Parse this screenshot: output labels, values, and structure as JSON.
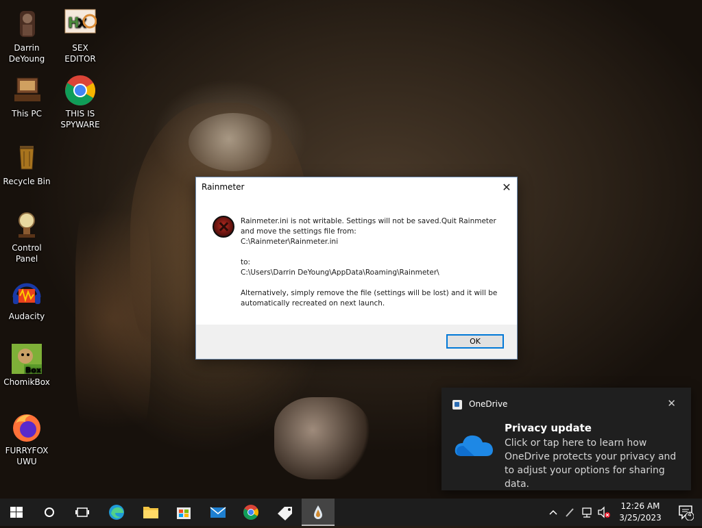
{
  "desktop": {
    "icons": [
      {
        "label": "Darrin\nDeYoung",
        "icon": "user-folder-icon"
      },
      {
        "label": "SEX\nEDITOR",
        "icon": "hex-editor-icon"
      },
      {
        "label": "This PC",
        "icon": "computer-icon"
      },
      {
        "label": "THIS IS\nSPYWARE",
        "icon": "chrome-icon"
      },
      {
        "label": "Recycle Bin",
        "icon": "recycle-bin-icon"
      },
      {
        "label": "Control Panel",
        "icon": "control-panel-icon"
      },
      {
        "label": "Audacity",
        "icon": "audacity-icon"
      },
      {
        "label": "ChomikBox",
        "icon": "chomikbox-icon"
      },
      {
        "label": "FURRYFOX\nUWU",
        "icon": "firefox-icon"
      }
    ]
  },
  "dialog": {
    "title": "Rainmeter",
    "close_glyph": "✕",
    "message_line1": "Rainmeter.ini is not writable. Settings will not be saved.Quit Rainmeter",
    "message_line2": "and move the settings file from:",
    "message_line3": "C:\\Rainmeter\\Rainmeter.ini",
    "message_line4": "to:",
    "message_line5": "C:\\Users\\Darrin DeYoung\\AppData\\Roaming\\Rainmeter\\",
    "message_line6": "Alternatively, simply remove the file (settings will be lost) and it will be",
    "message_line7": "automatically recreated on next launch.",
    "ok_label": "OK"
  },
  "toast": {
    "app_name": "OneDrive",
    "close_glyph": "✕",
    "heading": "Privacy update",
    "body": "Click or tap here to learn how OneDrive protects your privacy and to adjust your options for sharing data."
  },
  "taskbar": {
    "time": "12:26 AM",
    "date": "3/25/2023",
    "notification_count": "4",
    "pinned": [
      "start",
      "search",
      "task-view",
      "edge",
      "file-explorer",
      "microsoft-store",
      "mail",
      "chrome",
      "tags-app",
      "rainmeter"
    ]
  }
}
